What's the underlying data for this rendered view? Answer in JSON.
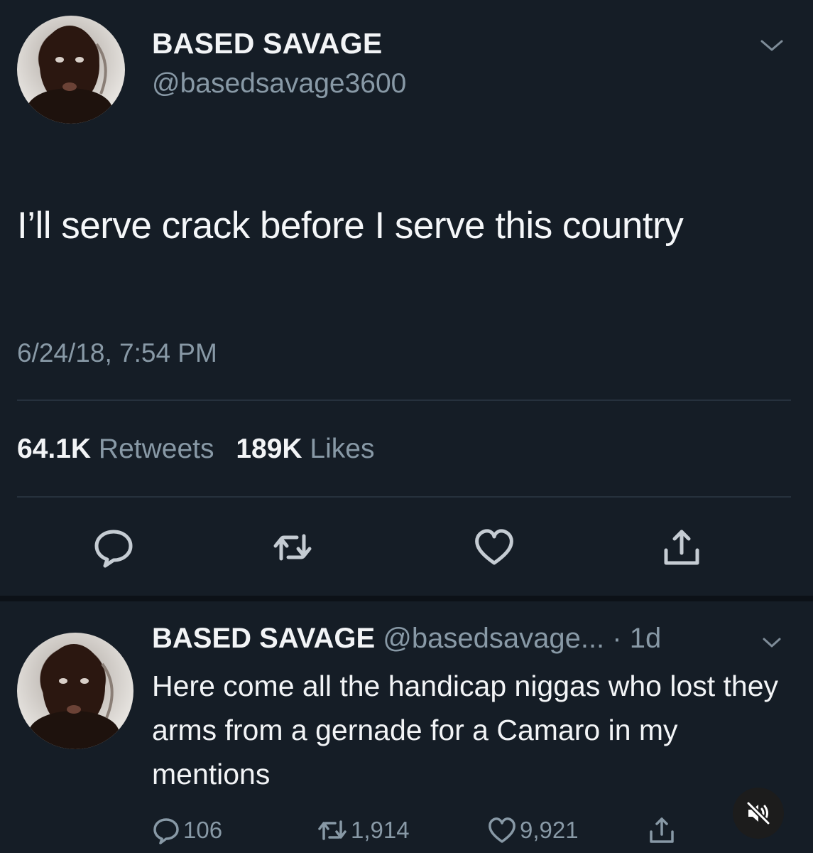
{
  "main_tweet": {
    "display_name": "BASED SAVAGE",
    "handle": "@basedsavage3600",
    "text": "I’ll serve crack before I serve this country",
    "timestamp": "6/24/18, 7:54 PM",
    "retweets_count": "64.1K",
    "retweets_label": "Retweets",
    "likes_count": "189K",
    "likes_label": "Likes"
  },
  "reply_tweet": {
    "display_name": "BASED SAVAGE",
    "handle": "@basedsavage...",
    "time": "· 1d",
    "text": "Here come all the handicap niggas who lost they arms from a gernade for a Camaro in my mentions",
    "replies_count": "106",
    "retweets_count": "1,914",
    "likes_count": "9,921"
  },
  "icons": {
    "menu": "chevron-down-icon",
    "reply": "speech-bubble-icon",
    "retweet": "retweet-icon",
    "like": "heart-icon",
    "share": "share-icon",
    "mute": "muted-speaker-icon"
  },
  "colors": {
    "background": "#151d26",
    "primary_text": "#f2f4f6",
    "secondary_text": "#8899a6",
    "divider": "#26313d"
  }
}
